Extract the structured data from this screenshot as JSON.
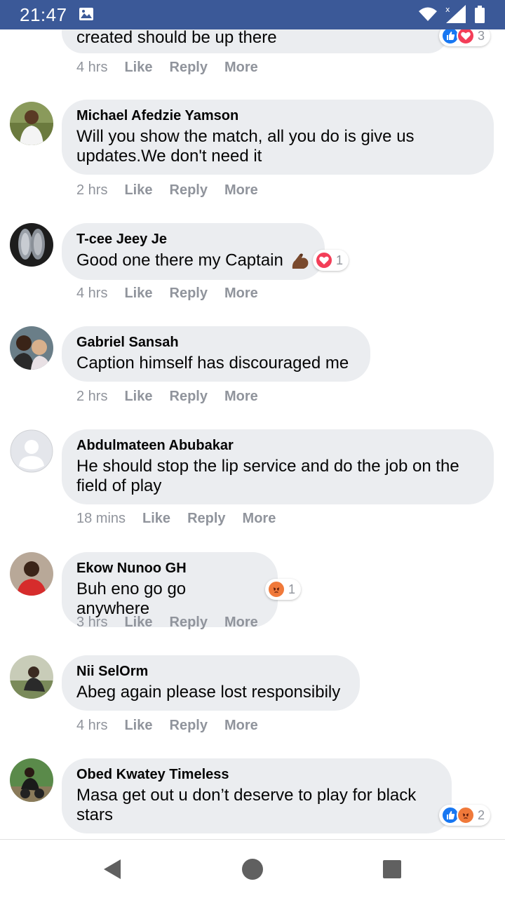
{
  "status_bar": {
    "time": "21:47",
    "icons": [
      "image-icon",
      "wifi-icon",
      "signal-icon",
      "battery-icon"
    ]
  },
  "comments": [
    {
      "name": "",
      "text": "created should be up there",
      "time": "4 hrs",
      "like": "Like",
      "reply": "Reply",
      "more": "More",
      "reactions": {
        "icons": [
          "like",
          "love"
        ],
        "count": "3"
      }
    },
    {
      "name": "Michael Afedzie Yamson",
      "text": "Will you show the match, all you do is give us updates.We don't need it",
      "time": "2 hrs",
      "like": "Like",
      "reply": "Reply",
      "more": "More"
    },
    {
      "name": "T-cee Jeey Je",
      "text": "Good one there my Captain",
      "emoji": "flexed-biceps",
      "time": "4 hrs",
      "like": "Like",
      "reply": "Reply",
      "more": "More",
      "reactions": {
        "icons": [
          "love"
        ],
        "count": "1"
      }
    },
    {
      "name": "Gabriel Sansah",
      "text": "Caption himself has discouraged me",
      "time": "2 hrs",
      "like": "Like",
      "reply": "Reply",
      "more": "More"
    },
    {
      "name": "Abdulmateen Abubakar",
      "text": "He should stop the lip service and do the job on the field of play",
      "time": "18 mins",
      "like": "Like",
      "reply": "Reply",
      "more": "More"
    },
    {
      "name": "Ekow Nunoo GH",
      "text": "Buh eno go go anywhere",
      "time": "3 hrs",
      "like": "Like",
      "reply": "Reply",
      "more": "More",
      "reactions": {
        "icons": [
          "angry"
        ],
        "count": "1"
      }
    },
    {
      "name": "Nii SelOrm",
      "text": "Abeg again please lost responsibily",
      "time": "4 hrs",
      "like": "Like",
      "reply": "Reply",
      "more": "More"
    },
    {
      "name": "Obed Kwatey Timeless",
      "text": "Masa get out u don’t deserve to play for black stars",
      "reactions": {
        "icons": [
          "like",
          "angry"
        ],
        "count": "2"
      }
    }
  ],
  "colors": {
    "status_bar": "#3b5998",
    "bubble": "#ebedf0",
    "meta_text": "#90949c",
    "like": "#1877f2",
    "love": "#f33e58",
    "angry": "#f0793a"
  },
  "nav_bar": {
    "icons": [
      "back-icon",
      "home-icon",
      "recents-icon"
    ]
  }
}
